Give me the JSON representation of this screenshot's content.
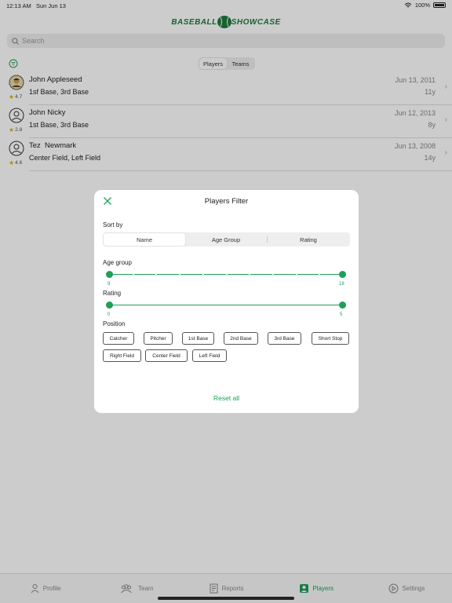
{
  "status": {
    "time": "12:13 AM",
    "date": "Sun Jun 13",
    "battery": "100%"
  },
  "logo": {
    "left": "BASEBALL",
    "right": "SHOWCASE"
  },
  "search": {
    "placeholder": "Search"
  },
  "top_tabs": [
    "Players",
    "Teams"
  ],
  "players": [
    {
      "name": "John Appleseed",
      "positions": "1sf Base, 3rd Base",
      "date": "Jun 13, 2011",
      "age": "11y",
      "rating": "4.7"
    },
    {
      "name": "John Nicky",
      "positions": "1st Base, 3rd Base",
      "date": "Jun 12, 2013",
      "age": "8y",
      "rating": "2.8"
    },
    {
      "name": "Tez  Newmark",
      "positions": "Center Field, Left Field",
      "date": "Jun 13, 2008",
      "age": "14y",
      "rating": "4.6"
    }
  ],
  "tabbar": [
    "Profile",
    "Team",
    "Reports",
    "Players",
    "Settings"
  ],
  "modal": {
    "title": "Players Filter",
    "sort_label": "Sort by",
    "sort_options": [
      "Name",
      "Age Group",
      "Rating"
    ],
    "age_label": "Age group",
    "age_min": "9",
    "age_max": "18",
    "rating_label": "Rating",
    "rating_min": "0",
    "rating_max": "5",
    "position_label": "Position",
    "positions": [
      "Catcher",
      "Pitcher",
      "1st Base",
      "2nd Base",
      "3rd Base",
      "Short Stop",
      "Right Field",
      "Center Field",
      "Left Field"
    ],
    "reset": "Reset all"
  },
  "colors": {
    "accent": "#1e9e58",
    "logo": "#1e7b3c"
  }
}
